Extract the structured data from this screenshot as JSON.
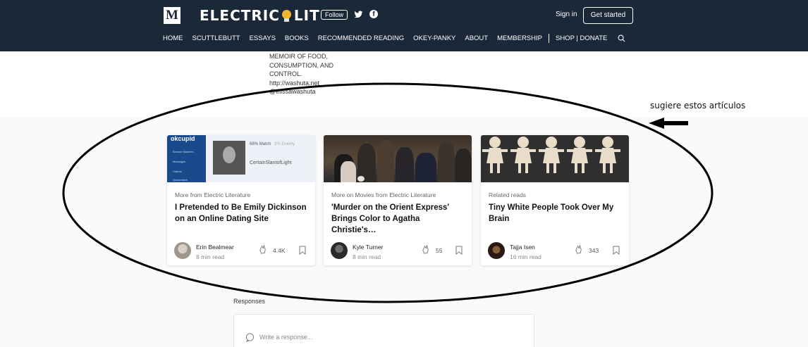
{
  "header": {
    "logo_letter": "M",
    "brand_left": "ELECTRIC",
    "brand_right": "LIT",
    "follow_label": "Follow",
    "signin_label": "Sign in",
    "get_started_label": "Get started",
    "nav": [
      "HOME",
      "SCUTTLEBUTT",
      "ESSAYS",
      "BOOKS",
      "RECOMMENDED READING",
      "OKEY-PANKY",
      "ABOUT",
      "MEMBERSHIP",
      "SHOP | DONATE"
    ]
  },
  "bio": {
    "lines": [
      "MEMOIR OF FOOD,",
      "CONSUMPTION, AND",
      "CONTROL.",
      "http://washuta.net",
      "@elissawashuta"
    ]
  },
  "annotation": {
    "text": "sugiere estos artículos"
  },
  "cards": [
    {
      "kicker": "More from Electric Literature",
      "title": "I Pretended to Be Emily Dickinson on an Online Dating Site",
      "author": "Erin Bealmear",
      "read_time": "8 min read",
      "claps": "4.4K",
      "thumb": {
        "logo": "okcupid",
        "stat1": "68%",
        "stat1_label": "Match",
        "stat2": "3%",
        "stat2_label": "Enemy",
        "profile_name": "CertainSlantofLight",
        "sidebar_items": [
          "Browse Matches",
          "Messages",
          "Visitors",
          "Quickmatch"
        ]
      }
    },
    {
      "kicker": "More on Movies from Electric Literature",
      "title": "'Murder on the Orient Express' Brings Color to Agatha Christie's…",
      "author": "Kyle Turner",
      "read_time": "8 min read",
      "claps": "55"
    },
    {
      "kicker": "Related reads",
      "title": "Tiny White People Took Over My Brain",
      "author": "Tajja Isen",
      "read_time": "16 min read",
      "claps": "343"
    }
  ],
  "responses": {
    "label": "Responses",
    "placeholder": "Write a response..."
  },
  "colors": {
    "header_bg": "#1b2838",
    "page_bg": "#fafafa",
    "bulb": "#f2b632"
  }
}
